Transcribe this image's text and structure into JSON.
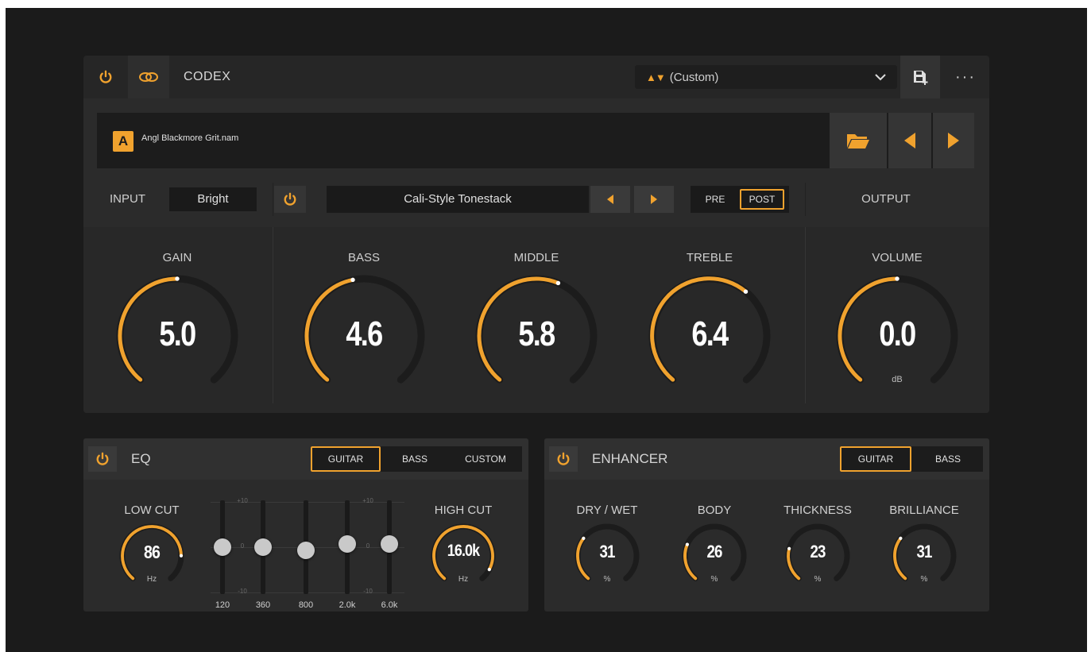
{
  "header": {
    "title": "CODEX",
    "preset": "(Custom)",
    "more": "···"
  },
  "amp": {
    "slot": "A",
    "model": "Angl Blackmore Grit.nam",
    "input_label": "INPUT",
    "input_value": "Bright",
    "tonestack": "Cali-Style Tonestack",
    "pre": "PRE",
    "post": "POST",
    "output_label": "OUTPUT",
    "knobs": [
      {
        "title": "GAIN",
        "value": "5.0",
        "level": 0.5
      },
      {
        "title": "BASS",
        "value": "4.6",
        "level": 0.46
      },
      {
        "title": "MIDDLE",
        "value": "5.8",
        "level": 0.58
      },
      {
        "title": "TREBLE",
        "value": "6.4",
        "level": 0.64
      },
      {
        "title": "VOLUME",
        "value": "0.0",
        "unit": "dB",
        "level": 0.5
      }
    ]
  },
  "eq": {
    "title": "EQ",
    "tabs": [
      "GUITAR",
      "BASS",
      "CUSTOM"
    ],
    "active_tab": "GUITAR",
    "low_cut": {
      "title": "LOW CUT",
      "value": "86",
      "unit": "Hz",
      "level": 0.82
    },
    "high_cut": {
      "title": "HIGH CUT",
      "value": "16.0k",
      "unit": "Hz",
      "level": 0.92
    },
    "scale_top": "+10",
    "scale_mid": "0",
    "scale_bot": "-10",
    "bands": [
      {
        "label": "120",
        "gain": 0
      },
      {
        "label": "360",
        "gain": 0
      },
      {
        "label": "800",
        "gain": -1
      },
      {
        "label": "2.0k",
        "gain": 1
      },
      {
        "label": "6.0k",
        "gain": 1
      }
    ]
  },
  "enhancer": {
    "title": "ENHANCER",
    "tabs": [
      "GUITAR",
      "BASS"
    ],
    "active_tab": "GUITAR",
    "knobs": [
      {
        "title": "DRY / WET",
        "value": "31",
        "unit": "%",
        "level": 0.31
      },
      {
        "title": "BODY",
        "value": "26",
        "unit": "%",
        "level": 0.26
      },
      {
        "title": "THICKNESS",
        "value": "23",
        "unit": "%",
        "level": 0.23
      },
      {
        "title": "BRILLIANCE",
        "value": "31",
        "unit": "%",
        "level": 0.31
      }
    ]
  },
  "colors": {
    "accent": "#f0a22e",
    "track": "#1c1c1c",
    "panel": "#2b2b2b"
  }
}
